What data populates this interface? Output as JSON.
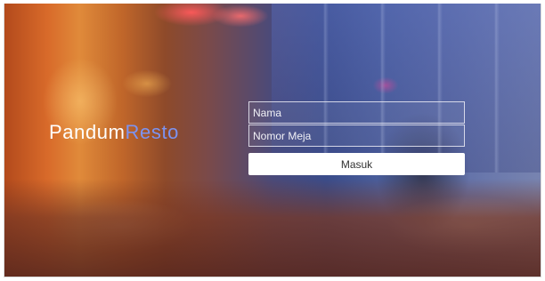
{
  "brand": {
    "part1": "Pandum",
    "part2": "Resto",
    "accent_color": "#7c93f0"
  },
  "form": {
    "name_placeholder": "Nama",
    "table_placeholder": "Nomor Meja",
    "submit_label": "Masuk"
  }
}
